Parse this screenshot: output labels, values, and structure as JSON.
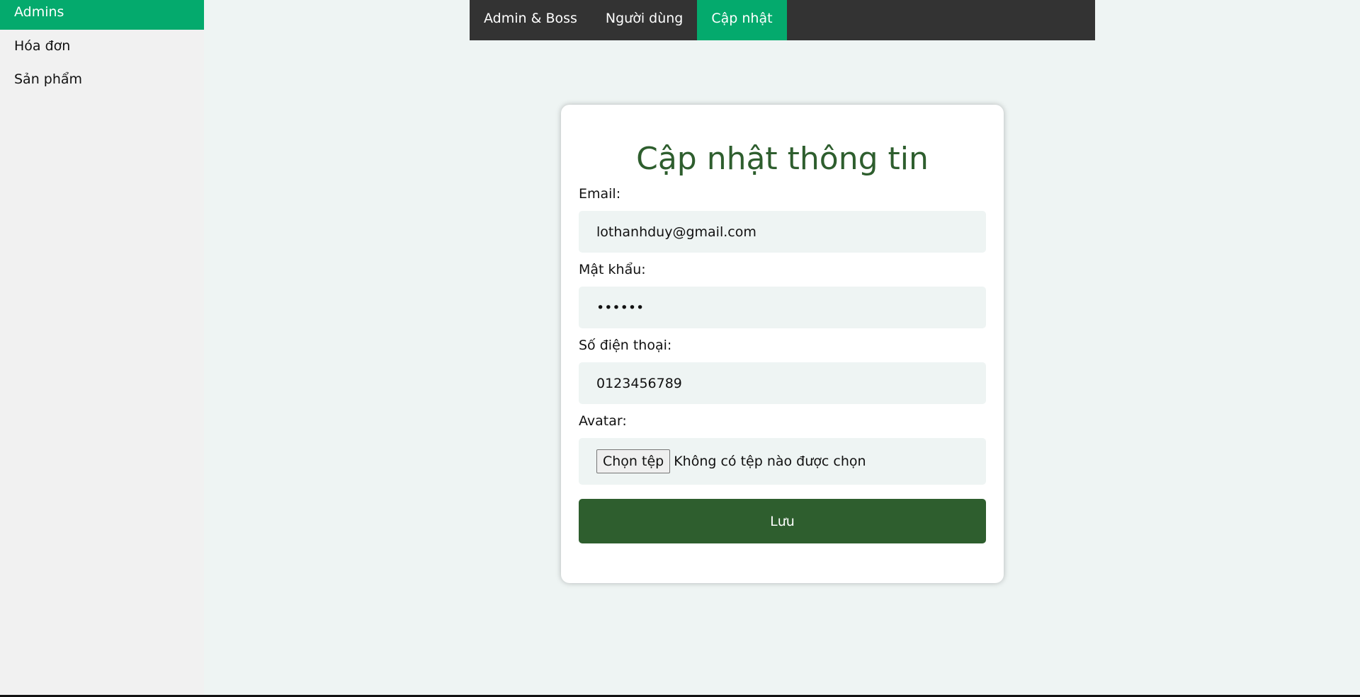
{
  "sidebar": {
    "items": [
      {
        "label": "Admins"
      },
      {
        "label": "Hóa đơn"
      },
      {
        "label": "Sản phẩm"
      }
    ]
  },
  "topnav": {
    "items": [
      {
        "label": "Admin & Boss"
      },
      {
        "label": "Người dùng"
      },
      {
        "label": "Cập nhật"
      }
    ]
  },
  "form": {
    "title": "Cập nhật thông tin",
    "email_label": "Email:",
    "email_value": "lothanhduy@gmail.com",
    "password_label": "Mật khẩu:",
    "password_value": "123456",
    "phone_label": "Số điện thoại:",
    "phone_value": "0123456789",
    "avatar_label": "Avatar:",
    "file_button_label": "Chọn tệp",
    "file_status": "Không có tệp nào được chọn",
    "save_label": "Lưu"
  },
  "colors": {
    "accent": "#04aa6d",
    "dark_green": "#2e5e2e",
    "nav_bg": "#333333"
  }
}
